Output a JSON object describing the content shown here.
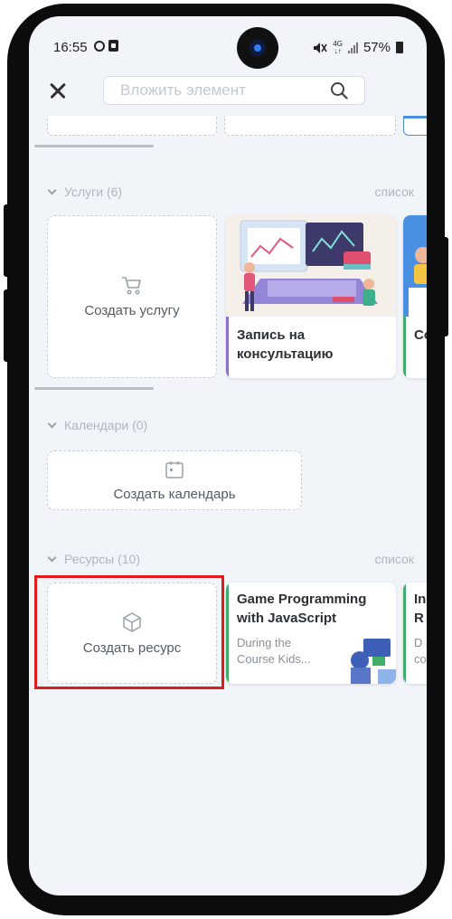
{
  "status_bar": {
    "time": "16:55",
    "network": "4G",
    "battery": "57%"
  },
  "top_bar": {
    "search_placeholder": "Вложить элемент"
  },
  "sections": {
    "services": {
      "title": "Услуги (6)",
      "view_link": "список",
      "create_label": "Создать услугу",
      "cards": [
        {
          "title": "Запись на консультацию"
        },
        {
          "title": "Co"
        }
      ]
    },
    "calendars": {
      "title": "Календари (0)",
      "create_label": "Создать календарь"
    },
    "resources": {
      "title": "Ресурсы (10)",
      "view_link": "список",
      "create_label": "Создать ресурс",
      "cards": [
        {
          "title": "Game Programming with JavaScript",
          "description": "During the Course Kids..."
        },
        {
          "title": "In R",
          "description": "D co"
        }
      ]
    }
  },
  "colors": {
    "screen_bg": "#f1f4f9",
    "service_accent": "#8a6fc7",
    "resource_accent": "#3fae6a",
    "highlight": "#e01b1b"
  }
}
